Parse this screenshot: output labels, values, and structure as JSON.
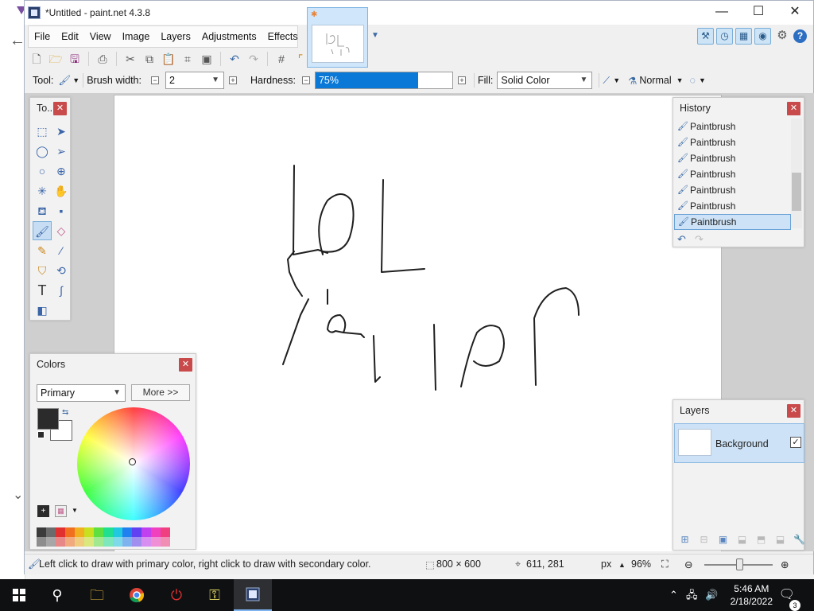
{
  "window": {
    "title": "*Untitled - paint.net 4.3.8",
    "controls": {
      "minimize": "—",
      "maximize": "☐",
      "close": "✕"
    }
  },
  "menu": [
    "File",
    "Edit",
    "View",
    "Image",
    "Layers",
    "Adjustments",
    "Effects"
  ],
  "options": {
    "tool_label": "Tool:",
    "brush_width_label": "Brush width:",
    "brush_width_value": "2",
    "hardness_label": "Hardness:",
    "hardness_value": "75%",
    "hardness_fraction": 0.75,
    "fill_label": "Fill:",
    "fill_value": "Solid Color",
    "blend_mode": "Normal"
  },
  "tools_palette": {
    "title": "To...",
    "tools": [
      "rectangle-select-icon",
      "move-selection-icon",
      "lasso-icon",
      "move-selected-icon",
      "ellipse-select-icon",
      "zoom-icon",
      "magic-wand-icon",
      "pan-icon",
      "paint-bucket-icon",
      "gradient-icon",
      "paintbrush-icon",
      "eraser-icon",
      "pencil-icon",
      "color-picker-icon",
      "clone-stamp-icon",
      "recolor-icon",
      "text-icon",
      "line-curve-icon",
      "shapes-icon"
    ]
  },
  "history": {
    "title": "History",
    "items": [
      "Paintbrush",
      "Paintbrush",
      "Paintbrush",
      "Paintbrush",
      "Paintbrush",
      "Paintbrush",
      "Paintbrush"
    ],
    "selected_index": 6
  },
  "colors": {
    "title": "Colors",
    "mode": "Primary",
    "more_label": "More >>",
    "primary": "#2b2b2b",
    "secondary": "#ffffff",
    "palette": [
      "#3b3b3b",
      "#6b6b6b",
      "#e03030",
      "#f07020",
      "#f0b020",
      "#c8e020",
      "#60e040",
      "#20e090",
      "#20c8e0",
      "#2080f0",
      "#6040f0",
      "#c040f0",
      "#f040c0",
      "#f04080"
    ]
  },
  "layers": {
    "title": "Layers",
    "items": [
      {
        "name": "Background",
        "visible": true
      }
    ]
  },
  "status": {
    "hint": "Left click to draw with primary color, right click to draw with secondary color.",
    "size": "800 × 600",
    "cursor": "611, 281",
    "units": "px",
    "zoom": "96%"
  },
  "taskbar": {
    "time": "5:46 AM",
    "date": "2/18/2022",
    "notifications": "3"
  }
}
